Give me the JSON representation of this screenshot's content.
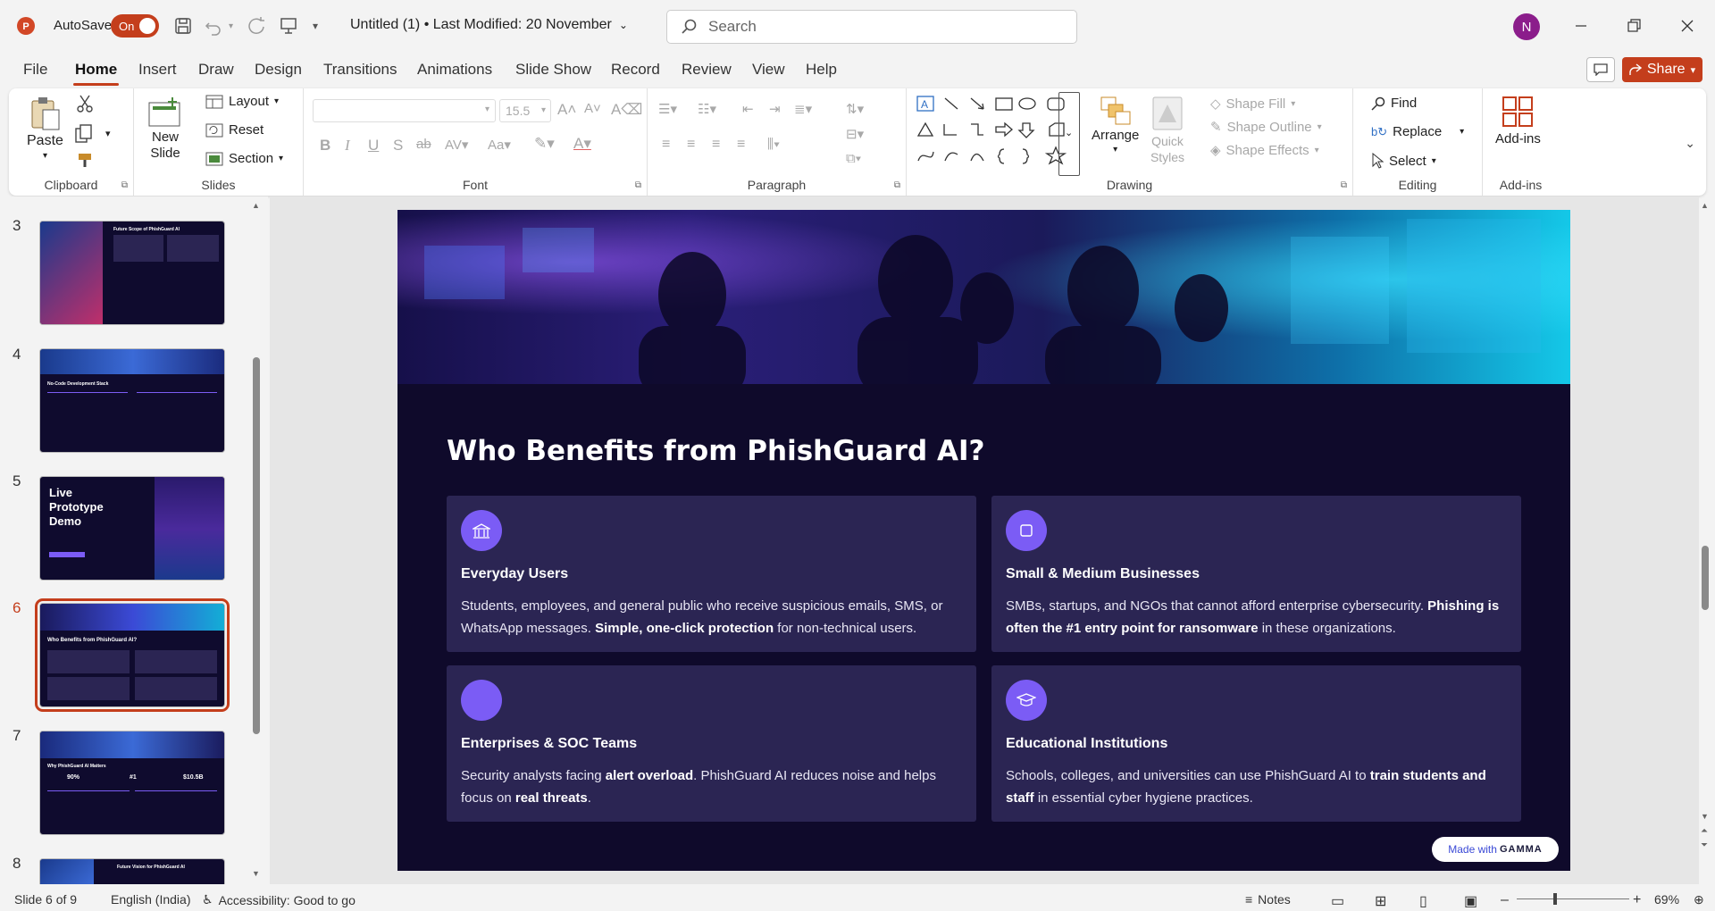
{
  "titlebar": {
    "autosave_label": "AutoSave",
    "autosave_state": "On",
    "doc_title": "Untitled (1)  •  Last Modified: 20 November",
    "search_placeholder": "Search",
    "user_initial": "N"
  },
  "ribbon_tabs": [
    "File",
    "Home",
    "Insert",
    "Draw",
    "Design",
    "Transitions",
    "Animations",
    "Slide Show",
    "Record",
    "Review",
    "View",
    "Help"
  ],
  "share_label": "Share",
  "ribbon": {
    "clipboard": {
      "paste": "Paste",
      "label": "Clipboard"
    },
    "slides": {
      "new_slide": "New Slide",
      "layout": "Layout",
      "reset": "Reset",
      "section": "Section",
      "label": "Slides"
    },
    "font": {
      "size": "15.5",
      "label": "Font"
    },
    "paragraph": {
      "label": "Paragraph"
    },
    "drawing": {
      "arrange": "Arrange",
      "quick_styles": "Quick Styles",
      "shape_fill": "Shape Fill",
      "shape_outline": "Shape Outline",
      "shape_effects": "Shape Effects",
      "label": "Drawing"
    },
    "editing": {
      "find": "Find",
      "replace": "Replace",
      "select": "Select",
      "label": "Editing"
    },
    "addins": {
      "addins": "Add-ins",
      "label": "Add-ins"
    }
  },
  "thumbnails": [
    {
      "num": "3",
      "title": "Future Scope of PhishGuard AI"
    },
    {
      "num": "4",
      "title": "No-Code Development Stack"
    },
    {
      "num": "5",
      "title": "Live Prototype Demo"
    },
    {
      "num": "6",
      "title": "Who Benefits from PhishGuard AI?"
    },
    {
      "num": "7",
      "title": "Why PhishGuard AI Matters",
      "stats": [
        "90%",
        "#1",
        "$10.5B"
      ]
    },
    {
      "num": "8",
      "title": "Future Vision for PhishGuard AI"
    }
  ],
  "slide": {
    "title": "Who Benefits from PhishGuard AI?",
    "cards": [
      {
        "icon": "building-icon",
        "title": "Everyday Users",
        "text_a": "Students, employees, and general public who receive suspicious emails, SMS, or WhatsApp messages. ",
        "bold": "Simple, one-click protection",
        "text_b": " for non-technical users."
      },
      {
        "icon": "square-icon",
        "title": "Small & Medium Businesses",
        "text_a": "SMBs, startups, and NGOs that cannot afford enterprise cybersecurity. ",
        "bold": "Phishing is often the #1 entry point for ransomware",
        "text_b": " in these organizations."
      },
      {
        "icon": "blank-icon",
        "title": "Enterprises & SOC Teams",
        "text_a": "Security analysts facing ",
        "bold": "alert overload",
        "text_b": ". PhishGuard AI reduces noise and helps focus on ",
        "bold2": "real threats",
        "text_c": "."
      },
      {
        "icon": "graduation-icon",
        "title": "Educational Institutions",
        "text_a": "Schools, colleges, and universities can use PhishGuard AI to ",
        "bold": "train students and staff",
        "text_b": " in essential cyber hygiene practices."
      }
    ],
    "badge_prefix": "Made with ",
    "badge_brand": "GAMMA"
  },
  "statusbar": {
    "slide_count": "Slide 6 of 9",
    "language": "English (India)",
    "accessibility": "Accessibility: Good to go",
    "notes": "Notes",
    "zoom": "69%",
    "zoom_level": 0.69
  },
  "colors": {
    "accent": "#c43e1c",
    "slide_bg": "#0f0a2b",
    "card_bg": "#2b2553",
    "icon_purple": "#7b5cf5"
  }
}
